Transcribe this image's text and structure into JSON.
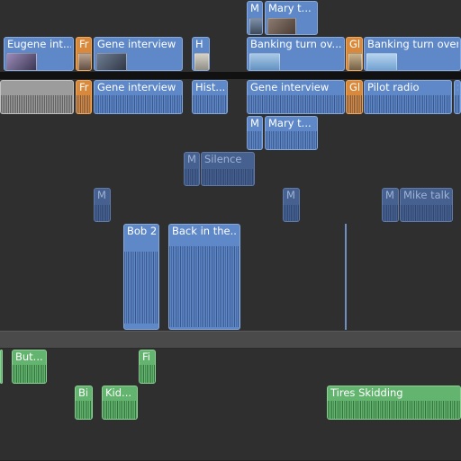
{
  "timeline": {
    "lanes": {
      "top_connected": "",
      "primary_video": "",
      "separator": "",
      "primary_audio": "",
      "connected_audio_1": "",
      "connected_audio_2": "",
      "connected_audio_3": "",
      "connected_audio_bob": "",
      "storyline_divider": "",
      "effects_1": "",
      "effects_2": "",
      "bottom": ""
    },
    "video_clips": [
      {
        "name": "M",
        "kind": "blue"
      },
      {
        "name": "Mary t...",
        "kind": "blue"
      },
      {
        "name": "Eugene int...",
        "kind": "blue"
      },
      {
        "name": "Fr",
        "kind": "orange"
      },
      {
        "name": "Gene interview",
        "kind": "blue"
      },
      {
        "name": "H",
        "kind": "blue"
      },
      {
        "name": "Banking turn ov...",
        "kind": "blue"
      },
      {
        "name": "Gl",
        "kind": "orange"
      },
      {
        "name": "Banking turn over",
        "kind": "blue"
      }
    ],
    "audio_clips": [
      {
        "name": "",
        "kind": "grey"
      },
      {
        "name": "Fr",
        "kind": "orange"
      },
      {
        "name": "Gene interview",
        "kind": "blue"
      },
      {
        "name": "Hist...",
        "kind": "blue"
      },
      {
        "name": "Gene interview",
        "kind": "blue"
      },
      {
        "name": "Gl",
        "kind": "orange"
      },
      {
        "name": "Pilot radio",
        "kind": "blue"
      },
      {
        "name": "S",
        "kind": "blue"
      },
      {
        "name": "M",
        "kind": "blue"
      },
      {
        "name": "Mary t...",
        "kind": "blue"
      },
      {
        "name": "Mi",
        "kind": "blue-dim"
      },
      {
        "name": "Silence",
        "kind": "blue-dim"
      },
      {
        "name": "M",
        "kind": "blue-dim"
      },
      {
        "name": "M",
        "kind": "blue-dim"
      },
      {
        "name": "M",
        "kind": "blue-dim"
      },
      {
        "name": "Mike talk",
        "kind": "blue-dim"
      },
      {
        "name": "Bob 2",
        "kind": "blue"
      },
      {
        "name": "Back in the...",
        "kind": "blue"
      }
    ],
    "effect_clips": [
      {
        "name": "",
        "kind": "green"
      },
      {
        "name": "But...",
        "kind": "green"
      },
      {
        "name": "Fi",
        "kind": "green"
      },
      {
        "name": "Bi",
        "kind": "green"
      },
      {
        "name": "Kid...",
        "kind": "green"
      },
      {
        "name": "Tires Skidding",
        "kind": "green"
      }
    ]
  }
}
